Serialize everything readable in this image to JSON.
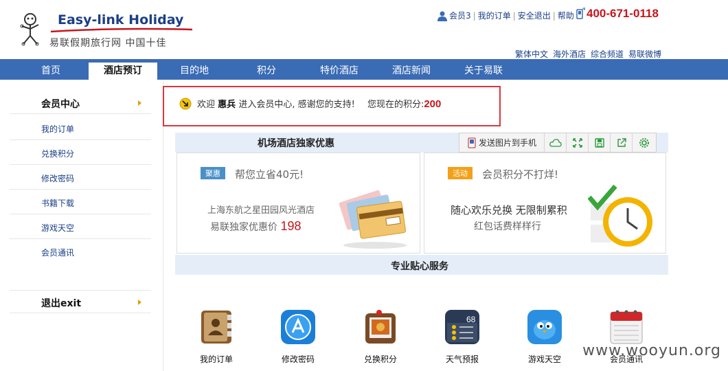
{
  "header": {
    "logo_en": "Easy-link Holiday",
    "logo_cn": "易联假期旅行网 中国十佳",
    "top_links": {
      "member": "会员3",
      "orders": "我的订单",
      "logout": "安全退出",
      "help": "帮助",
      "phone": "400-671-0118"
    },
    "sub_links": [
      "繁体中文",
      "海外酒店",
      "综合频道",
      "易联微博"
    ]
  },
  "nav": {
    "items": [
      "首页",
      "酒店预订",
      "目的地",
      "积分",
      "特价酒店",
      "酒店新闻",
      "关于易联"
    ],
    "active_index": 1
  },
  "sidebar": {
    "header": "会员中心",
    "items": [
      "我的订单",
      "兑换积分",
      "修改密码",
      "书籍下载",
      "游戏天空",
      "会员通讯"
    ],
    "logout": "退出exit"
  },
  "welcome": {
    "prefix": "欢迎",
    "name": "惠兵",
    "message": "进入会员中心, 感谢您的支持!",
    "points_label": "您现在的积分:",
    "points": "200"
  },
  "airport_section": {
    "title": "机场酒店独家优惠",
    "send_label": "发送图片到手机"
  },
  "promo_left": {
    "tag": "聚惠",
    "title": "帮您立省40元!",
    "line1": "上海东航之星田园风光酒店",
    "line2_prefix": "易联独家优惠价",
    "price": "198"
  },
  "promo_right": {
    "tag": "活动",
    "title": "会员积分不打烊!",
    "line1": "随心欢乐兑换 无限制累积",
    "line2": "红包话费样样行"
  },
  "service_section": {
    "title": "专业贴心服务",
    "items": [
      {
        "label": "我的订单",
        "icon": "contacts-book-icon"
      },
      {
        "label": "修改密码",
        "icon": "app-store-icon"
      },
      {
        "label": "兑换积分",
        "icon": "photo-pin-icon"
      },
      {
        "label": "天气预报",
        "icon": "weather-icon"
      },
      {
        "label": "游戏天空",
        "icon": "twitter-bird-icon"
      },
      {
        "label": "会员通讯",
        "icon": "calendar-icon"
      }
    ],
    "weather_temp": "68"
  },
  "watermark": "www.wooyun.org",
  "colors": {
    "nav_bg": "#3a6bb5",
    "link": "#1a3f86",
    "accent_red": "#c4161c",
    "highlight_border": "#d9363e",
    "section_bg": "#e5eef8"
  }
}
